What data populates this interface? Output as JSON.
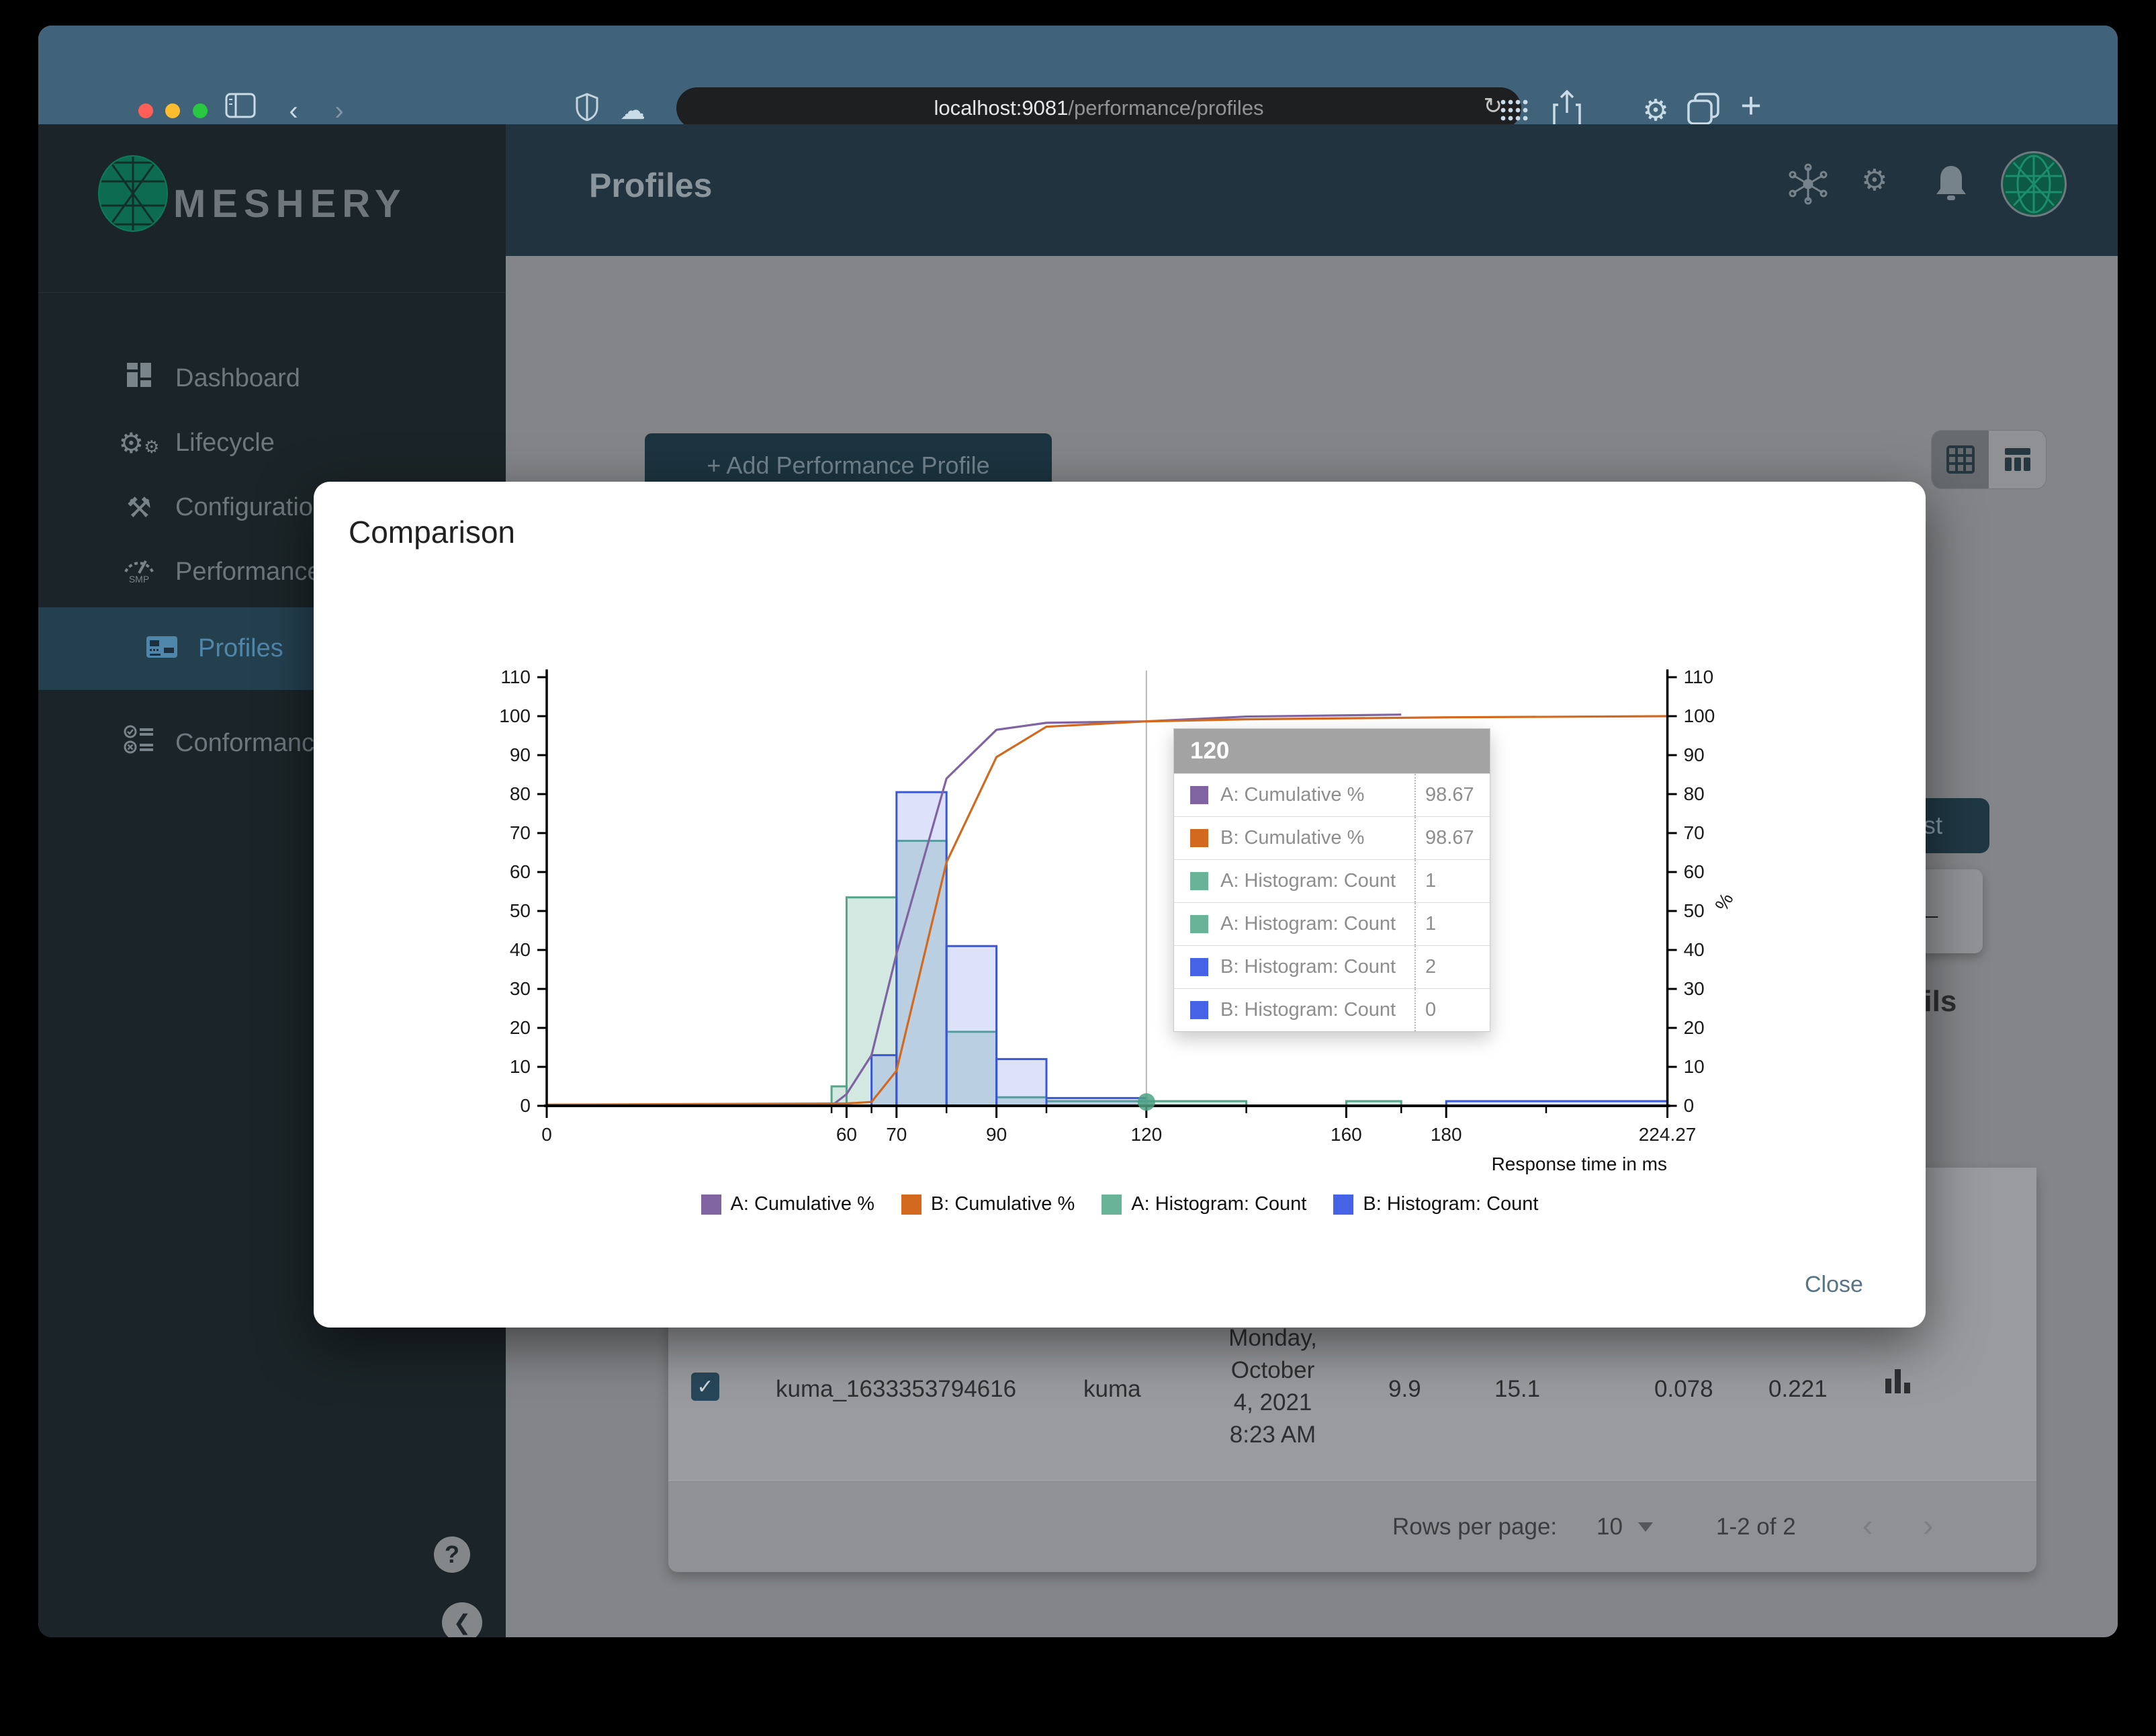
{
  "browser": {
    "url_host": "localhost:9081",
    "url_path": "/performance/profiles"
  },
  "sidebar": {
    "brand": "MESHERY",
    "performance_icon_text": "SMP",
    "items": [
      {
        "label": "Dashboard"
      },
      {
        "label": "Lifecycle"
      },
      {
        "label": "Configuration"
      },
      {
        "label": "Performance"
      },
      {
        "label": "Profiles",
        "active": true
      },
      {
        "label": "Conformance"
      }
    ]
  },
  "header": {
    "title": "Profiles"
  },
  "background": {
    "add_button_label": "+ Add Performance Profile",
    "run_test_label": "Run Test",
    "details_heading": "Details",
    "table_row": {
      "name": "kuma_1633353794616",
      "mesh": "kuma",
      "date_lines": [
        "Monday,",
        "October",
        "4, 2021",
        "8:23 AM"
      ],
      "qps": "9.9",
      "duration": "15.1",
      "p50": "0.078",
      "p99": "0.221"
    },
    "pagination": {
      "rows_per_page_label": "Rows per page:",
      "rows_per_page_value": "10",
      "range": "1-2 of 2"
    }
  },
  "modal": {
    "title": "Comparison",
    "close_label": "Close",
    "tooltip": {
      "title": "120",
      "rows": [
        {
          "color": "#8064a2",
          "label": "A: Cumulative %",
          "value": "98.67"
        },
        {
          "color": "#d2691e",
          "label": "B: Cumulative %",
          "value": "98.67"
        },
        {
          "color": "#69b398",
          "label": "A: Histogram: Count",
          "value": "1"
        },
        {
          "color": "#69b398",
          "label": "A: Histogram: Count",
          "value": "1"
        },
        {
          "color": "#4663e8",
          "label": "B: Histogram: Count",
          "value": "2"
        },
        {
          "color": "#4663e8",
          "label": "B: Histogram: Count",
          "value": "0"
        }
      ]
    },
    "chart_data": {
      "type": "combo-histogram-cumulative-line",
      "x_label": "Response time in ms",
      "y_right_label": "%",
      "x_range": [
        0,
        224.27
      ],
      "y_range": [
        0,
        110
      ],
      "x_ticks": [
        0,
        60,
        70,
        90,
        120,
        160,
        180,
        224.27
      ],
      "x_minor_ticks": [
        57,
        65,
        80,
        100,
        140,
        171,
        200
      ],
      "y_ticks": [
        0,
        10,
        20,
        30,
        40,
        50,
        60,
        70,
        80,
        90,
        100,
        110
      ],
      "hover_x": 120,
      "hover_marker": {
        "x": 120,
        "y": 1,
        "color": "#4da184"
      },
      "series": [
        {
          "name": "A: Cumulative %",
          "type": "line",
          "color": "#8064a2",
          "points": [
            [
              57,
              0
            ],
            [
              60,
              3
            ],
            [
              65,
              13
            ],
            [
              70,
              39
            ],
            [
              80,
              84
            ],
            [
              90,
              96.5
            ],
            [
              100,
              98.3
            ],
            [
              120,
              98.67
            ],
            [
              140,
              99.9
            ],
            [
              171,
              100.4
            ]
          ]
        },
        {
          "name": "B: Cumulative %",
          "type": "line",
          "color": "#d2691e",
          "points": [
            [
              0,
              0.3
            ],
            [
              60,
              0.6
            ],
            [
              65,
              1
            ],
            [
              70,
              9
            ],
            [
              80,
              62.5
            ],
            [
              90,
              89.5
            ],
            [
              100,
              97.3
            ],
            [
              120,
              98.67
            ],
            [
              140,
              99.2
            ],
            [
              180,
              99.7
            ],
            [
              224.27,
              100
            ]
          ]
        },
        {
          "name": "A: Histogram: Count",
          "type": "histogram",
          "color": "#55a389",
          "fill": "rgba(105,179,152,0.30)",
          "buckets": [
            [
              57,
              60,
              5
            ],
            [
              60,
              70,
              53.5
            ],
            [
              70,
              80,
              68
            ],
            [
              80,
              90,
              19
            ],
            [
              90,
              100,
              2.2
            ],
            [
              100,
              120,
              1.2
            ],
            [
              120,
              140,
              1.2
            ],
            [
              160,
              171,
              1.2
            ]
          ]
        },
        {
          "name": "B: Histogram: Count",
          "type": "histogram",
          "color": "#3a57d6",
          "fill": "rgba(99,123,232,0.22)",
          "buckets": [
            [
              65,
              70,
              13
            ],
            [
              70,
              80,
              80.5
            ],
            [
              80,
              90,
              41
            ],
            [
              90,
              100,
              12
            ],
            [
              100,
              120,
              2
            ],
            [
              180,
              224.27,
              1.2
            ]
          ]
        }
      ],
      "legend": [
        {
          "label": "A: Cumulative %",
          "color": "#8064a2"
        },
        {
          "label": "B: Cumulative %",
          "color": "#d2691e"
        },
        {
          "label": "A: Histogram: Count",
          "color": "#69b398"
        },
        {
          "label": "B: Histogram: Count",
          "color": "#4663e8"
        }
      ]
    }
  }
}
